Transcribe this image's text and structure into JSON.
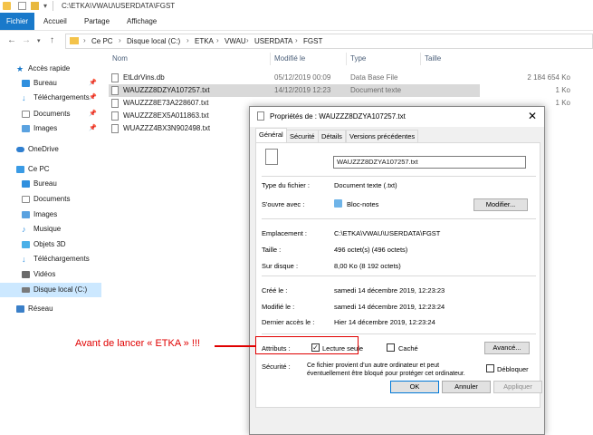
{
  "window": {
    "path": "C:\\ETKA\\VWAU\\USERDATA\\FGST"
  },
  "ribbon": {
    "tabs": [
      "Fichier",
      "Accueil",
      "Partage",
      "Affichage"
    ]
  },
  "address": {
    "crumbs": [
      "Ce PC",
      "Disque local (C:)",
      "ETKA",
      "VWAU",
      "USERDATA",
      "FGST"
    ]
  },
  "sidebar": {
    "items": [
      {
        "label": "Accès rapide",
        "pinned": false
      },
      {
        "label": "Bureau",
        "pinned": true
      },
      {
        "label": "Téléchargements",
        "pinned": true
      },
      {
        "label": "Documents",
        "pinned": true
      },
      {
        "label": "Images",
        "pinned": true
      },
      {
        "label": "OneDrive",
        "pinned": false
      },
      {
        "label": "Ce PC",
        "pinned": false
      },
      {
        "label": "Bureau",
        "pinned": false
      },
      {
        "label": "Documents",
        "pinned": false
      },
      {
        "label": "Images",
        "pinned": false
      },
      {
        "label": "Musique",
        "pinned": false
      },
      {
        "label": "Objets 3D",
        "pinned": false
      },
      {
        "label": "Téléchargements",
        "pinned": false
      },
      {
        "label": "Vidéos",
        "pinned": false
      },
      {
        "label": "Disque local (C:)",
        "pinned": false
      },
      {
        "label": "Réseau",
        "pinned": false
      }
    ]
  },
  "filelist": {
    "columns": [
      "Nom",
      "Modifié le",
      "Type",
      "Taille"
    ],
    "rows": [
      {
        "name": "EtLdrVins.db",
        "date": "05/12/2019 00:09",
        "type": "Data Base File",
        "size": "2 184 654 Ko"
      },
      {
        "name": "WAUZZZ8DZYA107257.txt",
        "date": "14/12/2019 12:23",
        "type": "Document texte",
        "size": "1 Ko"
      },
      {
        "name": "WAUZZZ8E73A228607.txt",
        "date": "",
        "type": "",
        "size": "1 Ko"
      },
      {
        "name": "WAUZZZ8EX5A011863.txt",
        "date": "",
        "type": "",
        "size": ""
      },
      {
        "name": "WUAZZZ4BX3N902498.txt",
        "date": "",
        "type": "",
        "size": ""
      }
    ]
  },
  "dialog": {
    "title": "Propriétés de : WAUZZZ8DZYA107257.txt",
    "tabs": [
      "Général",
      "Sécurité",
      "Détails",
      "Versions précédentes"
    ],
    "filename": "WAUZZZ8DZYA107257.txt",
    "type_label": "Type du fichier :",
    "type_value": "Document texte (.txt)",
    "opens_label": "S'ouvre avec :",
    "opens_value": "Bloc-notes",
    "modify_button": "Modifier...",
    "location_label": "Emplacement :",
    "location_value": "C:\\ETKA\\VWAU\\USERDATA\\FGST",
    "size_label": "Taille :",
    "size_value": "496 octet(s) (496 octets)",
    "disk_label": "Sur disque :",
    "disk_value": "8,00 Ko (8 192 octets)",
    "created_label": "Créé le :",
    "created_value": "samedi 14 décembre 2019, 12:23:23",
    "modified_label": "Modifié le :",
    "modified_value": "samedi 14 décembre 2019, 12:23:24",
    "accessed_label": "Dernier accès le :",
    "accessed_value": "Hier 14 décembre 2019, 12:23:24",
    "attributes_label": "Attributs :",
    "readonly_label": "Lecture seule",
    "readonly_checked": true,
    "hidden_label": "Caché",
    "advanced_button": "Avancé...",
    "security_label": "Sécurité :",
    "security_text_1": "Ce fichier provient d'un autre ordinateur et peut",
    "security_text_2": "éventuellement être bloqué pour protéger cet ordinateur.",
    "unblock_label": "Débloquer",
    "ok_button": "OK",
    "cancel_button": "Annuler",
    "apply_button": "Appliquer"
  },
  "annotation": {
    "text": "Avant de lancer « ETKA » !!!",
    "color": "#e00000"
  },
  "colors": {
    "accent": "#1979ca",
    "selection": "#cce8ff"
  }
}
